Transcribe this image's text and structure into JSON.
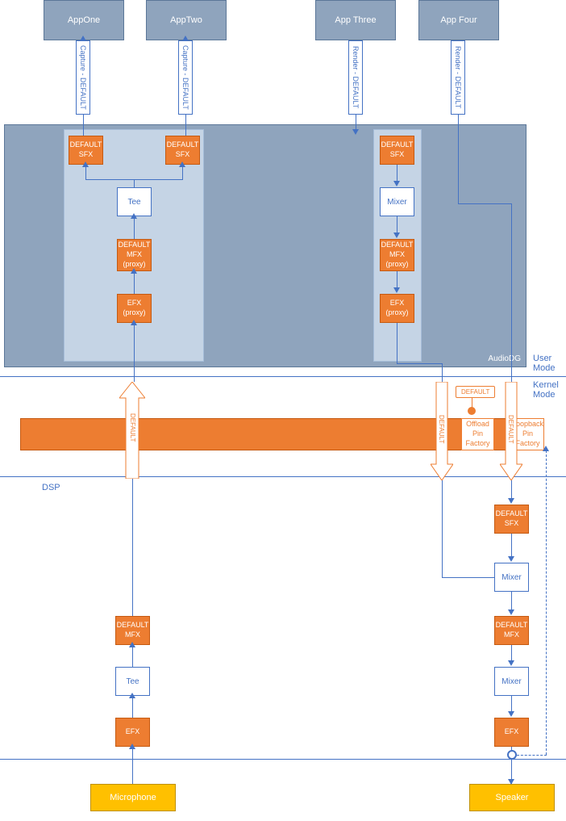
{
  "apps": {
    "one": "AppOne",
    "two": "AppTwo",
    "three": "App Three",
    "four": "App Four"
  },
  "pipes": {
    "capture": "Capture - DEFAULT",
    "render": "Render - DEFAULT"
  },
  "blocks": {
    "default_sfx": "DEFAULT\nSFX",
    "tee": "Tee",
    "default_mfx_proxy": "DEFAULT\nMFX\n(proxy)",
    "efx_proxy": "EFX\n(proxy)",
    "mixer": "Mixer",
    "default_mfx": "DEFAULT\nMFX",
    "efx": "EFX",
    "offload": "Offload\nPin\nFactory",
    "loopback": "Loopback\nPin\nFactory"
  },
  "labels": {
    "audiodg": "AudioDG",
    "user_mode": "User\nMode",
    "kernel_mode": "Kernel\nMode",
    "dsp": "DSP",
    "default": "DEFAULT",
    "microphone": "Microphone",
    "speaker": "Speaker"
  }
}
